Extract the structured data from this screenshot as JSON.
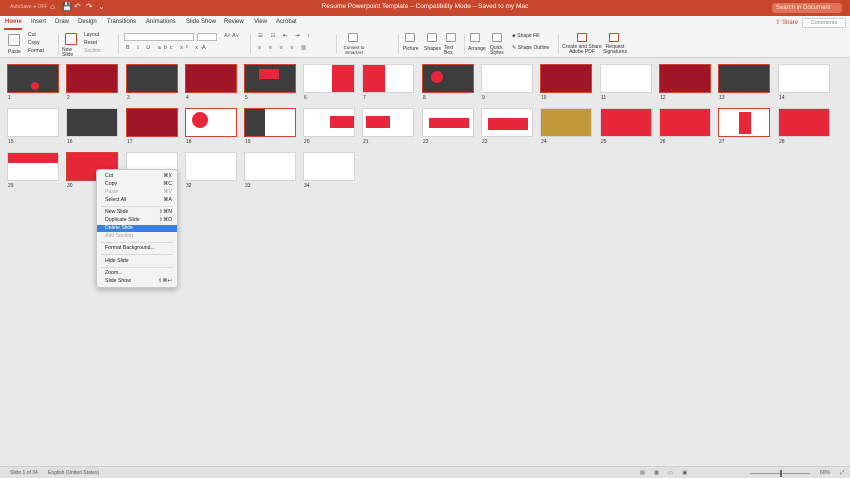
{
  "titlebar": {
    "autosave": "AutoSave ● OFF",
    "title": "Resume Powerpoint Template  –  Compatibility Mode  –  Saved to my Mac",
    "search_placeholder": "Search in Document",
    "qat": [
      "⌂",
      "💾",
      "↶",
      "↷",
      "⌄"
    ]
  },
  "tabs": [
    "Home",
    "Insert",
    "Draw",
    "Design",
    "Transitions",
    "Animations",
    "Slide Show",
    "Review",
    "View",
    "Acrobat"
  ],
  "share_label": "Share",
  "comments_label": "Comments",
  "ribbon": {
    "paste": "Paste",
    "cut": "Cut",
    "copy": "Copy",
    "format": "Format",
    "new_slide": "New Slide",
    "layout": "Layout",
    "reset": "Reset",
    "section": "Section",
    "convert_smartart": "Convert to SmartArt",
    "picture": "Picture",
    "shapes": "Shapes",
    "text_box": "Text Box",
    "arrange": "Arrange",
    "quick_styles": "Quick Styles",
    "shape_fill": "Shape Fill",
    "shape_outline": "Shape Outline",
    "create_share_pdf": "Create and Share Adobe PDF",
    "request_signatures": "Request Signatures"
  },
  "context_menu": {
    "cut": "Cut",
    "cut_sc": "⌘X",
    "copy": "Copy",
    "copy_sc": "⌘C",
    "paste": "Paste",
    "paste_sc": "⌘V",
    "select_all": "Select All",
    "select_all_sc": "⌘A",
    "new_slide": "New Slide",
    "new_slide_sc": "⇧⌘N",
    "duplicate_slide": "Duplicate Slide",
    "duplicate_slide_sc": "⇧⌘D",
    "delete_slide": "Delete Slide",
    "add_section": "Add Section",
    "format_background": "Format Background...",
    "hide_slide": "Hide Slide",
    "zoom": "Zoom...",
    "slide_show": "Slide Show",
    "slide_show_sc": "⇧⌘↩"
  },
  "slide_numbers": [
    "1",
    "2",
    "3",
    "4",
    "5",
    "6",
    "7",
    "8",
    "9",
    "10",
    "11",
    "12",
    "13",
    "14",
    "15",
    "16",
    "17",
    "18",
    "19",
    "20",
    "21",
    "22",
    "23",
    "24",
    "25",
    "26",
    "27",
    "28",
    "29",
    "30",
    "31",
    "32",
    "33",
    "34"
  ],
  "statusbar": {
    "slide_info": "Slide 1 of 34",
    "language": "English (United States)",
    "zoom": "60%"
  },
  "colors": {
    "brand": "#c8462b",
    "slide_red": "#e8263a",
    "slide_dark": "#3d3d3d",
    "highlight": "#3b7fe0"
  }
}
